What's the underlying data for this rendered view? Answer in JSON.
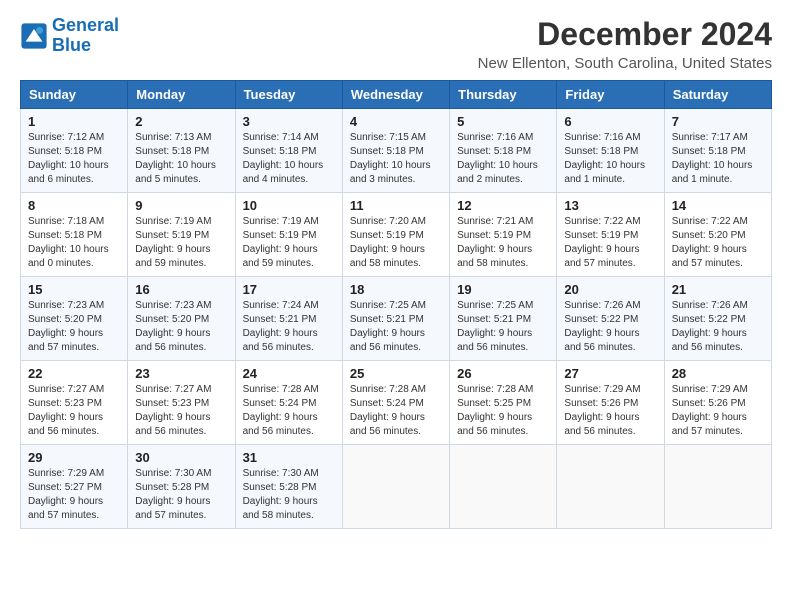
{
  "header": {
    "logo_line1": "General",
    "logo_line2": "Blue",
    "month": "December 2024",
    "location": "New Ellenton, South Carolina, United States"
  },
  "days_of_week": [
    "Sunday",
    "Monday",
    "Tuesday",
    "Wednesday",
    "Thursday",
    "Friday",
    "Saturday"
  ],
  "weeks": [
    [
      {
        "day": "1",
        "sunrise": "7:12 AM",
        "sunset": "5:18 PM",
        "daylight": "10 hours and 6 minutes."
      },
      {
        "day": "2",
        "sunrise": "7:13 AM",
        "sunset": "5:18 PM",
        "daylight": "10 hours and 5 minutes."
      },
      {
        "day": "3",
        "sunrise": "7:14 AM",
        "sunset": "5:18 PM",
        "daylight": "10 hours and 4 minutes."
      },
      {
        "day": "4",
        "sunrise": "7:15 AM",
        "sunset": "5:18 PM",
        "daylight": "10 hours and 3 minutes."
      },
      {
        "day": "5",
        "sunrise": "7:16 AM",
        "sunset": "5:18 PM",
        "daylight": "10 hours and 2 minutes."
      },
      {
        "day": "6",
        "sunrise": "7:16 AM",
        "sunset": "5:18 PM",
        "daylight": "10 hours and 1 minute."
      },
      {
        "day": "7",
        "sunrise": "7:17 AM",
        "sunset": "5:18 PM",
        "daylight": "10 hours and 1 minute."
      }
    ],
    [
      {
        "day": "8",
        "sunrise": "7:18 AM",
        "sunset": "5:18 PM",
        "daylight": "10 hours and 0 minutes."
      },
      {
        "day": "9",
        "sunrise": "7:19 AM",
        "sunset": "5:19 PM",
        "daylight": "9 hours and 59 minutes."
      },
      {
        "day": "10",
        "sunrise": "7:19 AM",
        "sunset": "5:19 PM",
        "daylight": "9 hours and 59 minutes."
      },
      {
        "day": "11",
        "sunrise": "7:20 AM",
        "sunset": "5:19 PM",
        "daylight": "9 hours and 58 minutes."
      },
      {
        "day": "12",
        "sunrise": "7:21 AM",
        "sunset": "5:19 PM",
        "daylight": "9 hours and 58 minutes."
      },
      {
        "day": "13",
        "sunrise": "7:22 AM",
        "sunset": "5:19 PM",
        "daylight": "9 hours and 57 minutes."
      },
      {
        "day": "14",
        "sunrise": "7:22 AM",
        "sunset": "5:20 PM",
        "daylight": "9 hours and 57 minutes."
      }
    ],
    [
      {
        "day": "15",
        "sunrise": "7:23 AM",
        "sunset": "5:20 PM",
        "daylight": "9 hours and 57 minutes."
      },
      {
        "day": "16",
        "sunrise": "7:23 AM",
        "sunset": "5:20 PM",
        "daylight": "9 hours and 56 minutes."
      },
      {
        "day": "17",
        "sunrise": "7:24 AM",
        "sunset": "5:21 PM",
        "daylight": "9 hours and 56 minutes."
      },
      {
        "day": "18",
        "sunrise": "7:25 AM",
        "sunset": "5:21 PM",
        "daylight": "9 hours and 56 minutes."
      },
      {
        "day": "19",
        "sunrise": "7:25 AM",
        "sunset": "5:21 PM",
        "daylight": "9 hours and 56 minutes."
      },
      {
        "day": "20",
        "sunrise": "7:26 AM",
        "sunset": "5:22 PM",
        "daylight": "9 hours and 56 minutes."
      },
      {
        "day": "21",
        "sunrise": "7:26 AM",
        "sunset": "5:22 PM",
        "daylight": "9 hours and 56 minutes."
      }
    ],
    [
      {
        "day": "22",
        "sunrise": "7:27 AM",
        "sunset": "5:23 PM",
        "daylight": "9 hours and 56 minutes."
      },
      {
        "day": "23",
        "sunrise": "7:27 AM",
        "sunset": "5:23 PM",
        "daylight": "9 hours and 56 minutes."
      },
      {
        "day": "24",
        "sunrise": "7:28 AM",
        "sunset": "5:24 PM",
        "daylight": "9 hours and 56 minutes."
      },
      {
        "day": "25",
        "sunrise": "7:28 AM",
        "sunset": "5:24 PM",
        "daylight": "9 hours and 56 minutes."
      },
      {
        "day": "26",
        "sunrise": "7:28 AM",
        "sunset": "5:25 PM",
        "daylight": "9 hours and 56 minutes."
      },
      {
        "day": "27",
        "sunrise": "7:29 AM",
        "sunset": "5:26 PM",
        "daylight": "9 hours and 56 minutes."
      },
      {
        "day": "28",
        "sunrise": "7:29 AM",
        "sunset": "5:26 PM",
        "daylight": "9 hours and 57 minutes."
      }
    ],
    [
      {
        "day": "29",
        "sunrise": "7:29 AM",
        "sunset": "5:27 PM",
        "daylight": "9 hours and 57 minutes."
      },
      {
        "day": "30",
        "sunrise": "7:30 AM",
        "sunset": "5:28 PM",
        "daylight": "9 hours and 57 minutes."
      },
      {
        "day": "31",
        "sunrise": "7:30 AM",
        "sunset": "5:28 PM",
        "daylight": "9 hours and 58 minutes."
      },
      null,
      null,
      null,
      null
    ]
  ],
  "labels": {
    "sunrise": "Sunrise:",
    "sunset": "Sunset:",
    "daylight": "Daylight:"
  }
}
